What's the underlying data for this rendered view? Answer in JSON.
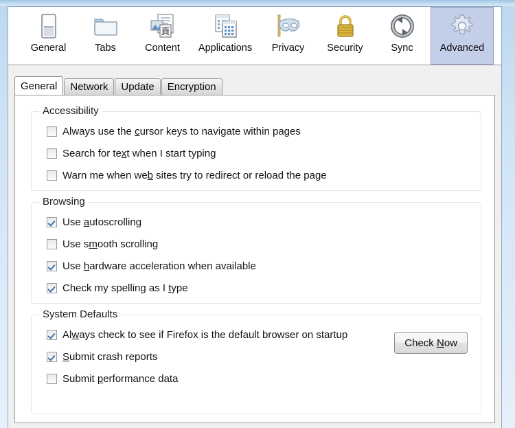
{
  "window": {
    "accent_selected_tab": "#c3cfe8",
    "panel_background": "#f0f0f0"
  },
  "toolbar": {
    "tabs": [
      {
        "label": "General",
        "icon": "general-switch-icon",
        "selected": false
      },
      {
        "label": "Tabs",
        "icon": "folder-icon",
        "selected": false
      },
      {
        "label": "Content",
        "icon": "content-page-icon",
        "selected": false
      },
      {
        "label": "Applications",
        "icon": "applications-icon",
        "selected": false
      },
      {
        "label": "Privacy",
        "icon": "mask-icon",
        "selected": false
      },
      {
        "label": "Security",
        "icon": "padlock-icon",
        "selected": false
      },
      {
        "label": "Sync",
        "icon": "sync-arrows-icon",
        "selected": false
      },
      {
        "label": "Advanced",
        "icon": "gear-icon",
        "selected": true
      }
    ]
  },
  "subtabs": [
    {
      "label": "General",
      "selected": true
    },
    {
      "label": "Network",
      "selected": false
    },
    {
      "label": "Update",
      "selected": false
    },
    {
      "label": "Encryption",
      "selected": false
    }
  ],
  "groups": {
    "accessibility": {
      "legend": "Accessibility",
      "items": [
        {
          "pre": "Always use the ",
          "accel": "c",
          "post": "ursor keys to navigate within pages",
          "checked": false
        },
        {
          "pre": "Search for te",
          "accel": "x",
          "post": "t when I start typing",
          "checked": false
        },
        {
          "pre": "Warn me when we",
          "accel": "b",
          "post": " sites try to redirect or reload the page",
          "checked": false
        }
      ]
    },
    "browsing": {
      "legend": "Browsing",
      "items": [
        {
          "pre": "Use ",
          "accel": "a",
          "post": "utoscrolling",
          "checked": true
        },
        {
          "pre": "Use s",
          "accel": "m",
          "post": "ooth scrolling",
          "checked": false
        },
        {
          "pre": "Use ",
          "accel": "h",
          "post": "ardware acceleration when available",
          "checked": true
        },
        {
          "pre": "Check my spelling as I ",
          "accel": "t",
          "post": "ype",
          "checked": true
        }
      ]
    },
    "system_defaults": {
      "legend": "System Defaults",
      "items": [
        {
          "pre": "Al",
          "accel": "w",
          "post": "ays check to see if Firefox is the default browser on startup",
          "checked": true
        },
        {
          "pre": "",
          "accel": "S",
          "post": "ubmit crash reports",
          "checked": true
        },
        {
          "pre": "Submit ",
          "accel": "p",
          "post": "erformance data",
          "checked": false
        }
      ],
      "button": {
        "pre": "Check ",
        "accel": "N",
        "post": "ow"
      }
    }
  }
}
